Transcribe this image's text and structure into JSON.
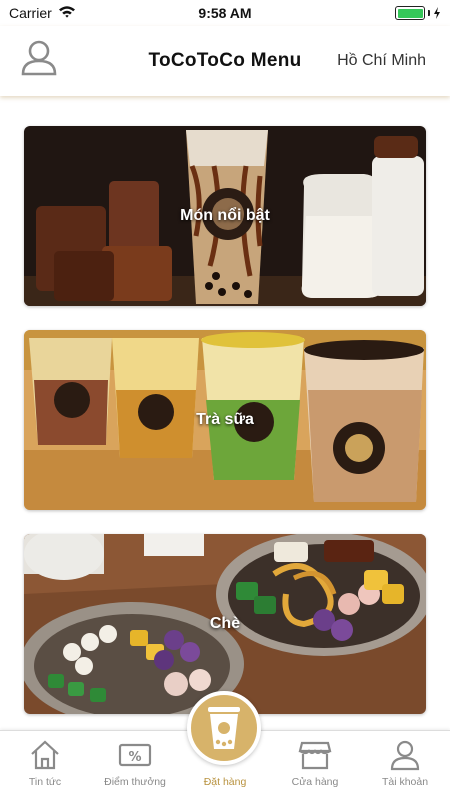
{
  "status_bar": {
    "carrier": "Carrier",
    "time": "9:58 AM"
  },
  "header": {
    "title": "ToCoToCo Menu",
    "city": "Hồ Chí Minh"
  },
  "categories": [
    {
      "label": "Món nổi bật"
    },
    {
      "label": "Trà sữa"
    },
    {
      "label": "Chè"
    }
  ],
  "tabbar": {
    "items": [
      {
        "label": "Tin tức",
        "icon": "house-icon"
      },
      {
        "label": "Điểm thưởng",
        "icon": "ticket-icon"
      },
      {
        "label": "Đặt hàng",
        "icon": "bubble-tea-icon",
        "active": true
      },
      {
        "label": "Cửa hàng",
        "icon": "store-icon"
      },
      {
        "label": "Tài khoản",
        "icon": "user-icon"
      }
    ]
  },
  "colors": {
    "accent": "#d7b36a",
    "active_label": "#b8923f",
    "inactive": "#8a8a8a"
  }
}
